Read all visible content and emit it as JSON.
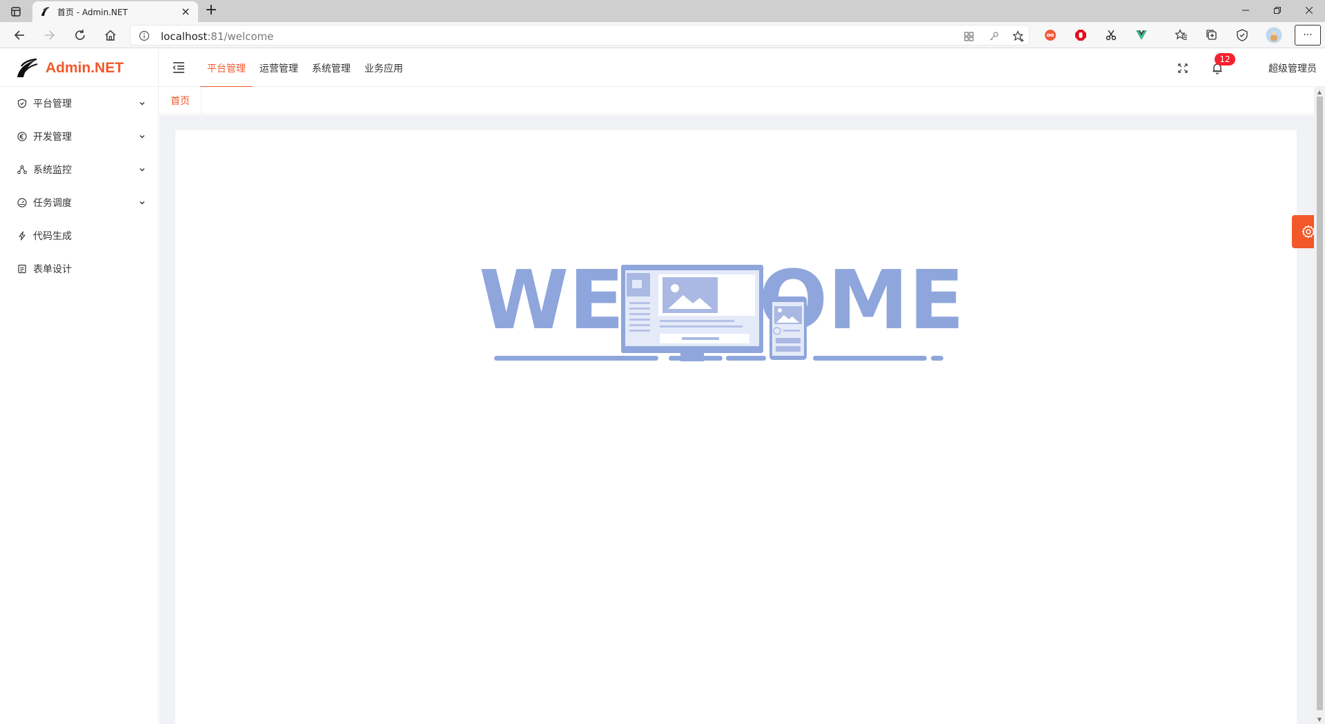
{
  "browser": {
    "tab_title": "首页 - Admin.NET",
    "new_tab": "+",
    "tab_close": "×",
    "url_host": "localhost",
    "url_rest": ":81/welcome",
    "more": "···"
  },
  "app": {
    "logo_text": "Admin.NET",
    "top_nav": [
      "平台管理",
      "运营管理",
      "系统管理",
      "业务应用"
    ],
    "active_top_nav": 0,
    "notification_count": "12",
    "username": "超级管理员",
    "accent_color": "#f2582a"
  },
  "sidebar": {
    "items": [
      {
        "label": "平台管理",
        "icon": "shield-icon",
        "expandable": true
      },
      {
        "label": "开发管理",
        "icon": "euro-circle-icon",
        "expandable": true
      },
      {
        "label": "系统监控",
        "icon": "network-icon",
        "expandable": true
      },
      {
        "label": "任务调度",
        "icon": "dashboard-gauge-icon",
        "expandable": true
      },
      {
        "label": "代码生成",
        "icon": "lightning-icon",
        "expandable": false
      },
      {
        "label": "表单设计",
        "icon": "form-icon",
        "expandable": false
      }
    ]
  },
  "tags": {
    "home": "首页"
  },
  "welcome": {
    "text_left": "WEL",
    "text_right": "OME",
    "color": "#8fa6dc"
  }
}
